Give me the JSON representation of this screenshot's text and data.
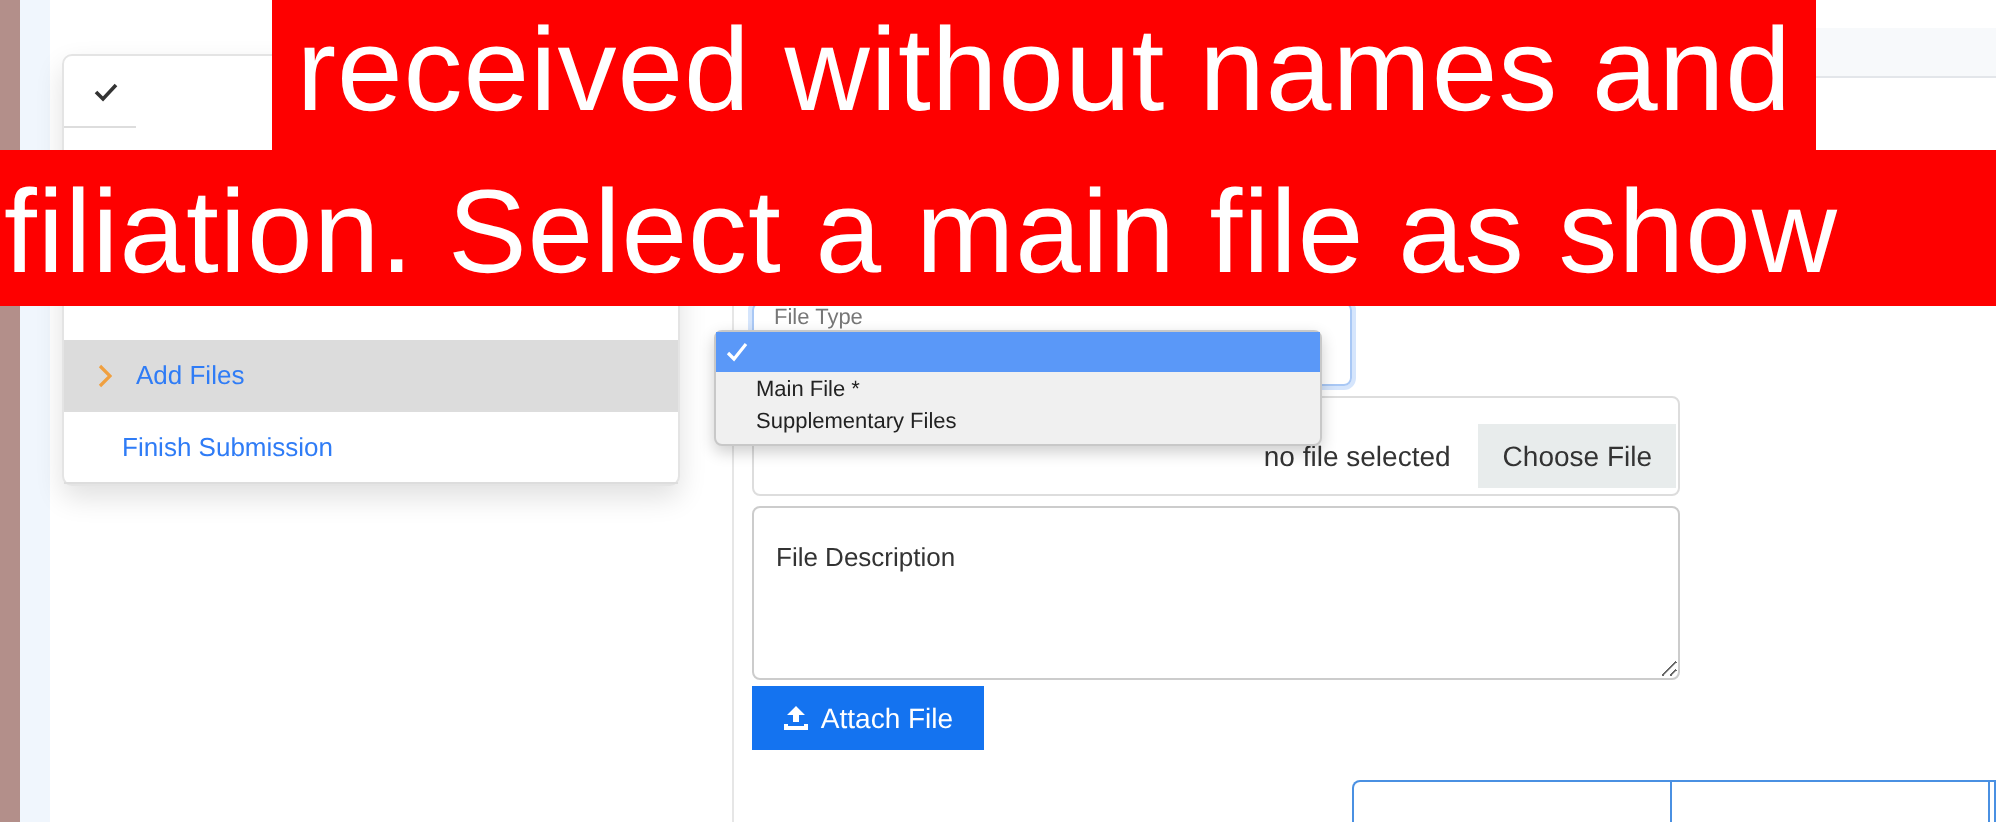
{
  "caption": {
    "lines": [
      "received without names and",
      "filiation. Select a main file as show"
    ]
  },
  "sidebar": {
    "items": [
      {
        "kind": "done",
        "selected": false
      },
      {
        "kind": "step",
        "label": "Add Files",
        "selected": true
      },
      {
        "kind": "step",
        "label": "Finish Submission",
        "selected": false
      }
    ]
  },
  "form": {
    "file_type": {
      "label": "File Type",
      "focused": true,
      "options": [
        {
          "selected": true
        },
        {
          "label": "Main File *",
          "selected": false
        },
        {
          "label": "Supplementary Files",
          "selected": false
        }
      ]
    },
    "file_name": {
      "status": "no file selected",
      "button": "Choose File"
    },
    "description": {
      "placeholder": "File Description"
    },
    "attach_button": "Attach File"
  }
}
